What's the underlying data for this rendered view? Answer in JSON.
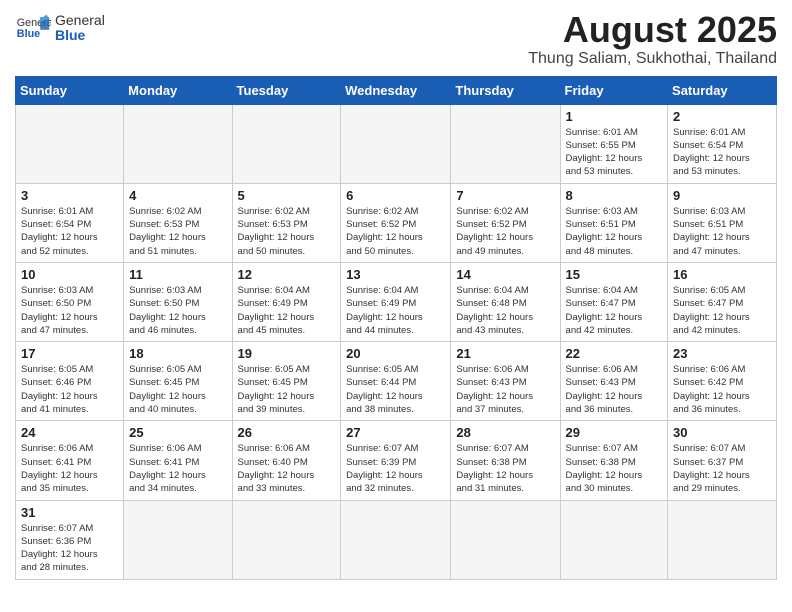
{
  "header": {
    "logo_general": "General",
    "logo_blue": "Blue",
    "month_year": "August 2025",
    "location": "Thung Saliam, Sukhothai, Thailand"
  },
  "weekdays": [
    "Sunday",
    "Monday",
    "Tuesday",
    "Wednesday",
    "Thursday",
    "Friday",
    "Saturday"
  ],
  "weeks": [
    [
      {
        "day": "",
        "info": ""
      },
      {
        "day": "",
        "info": ""
      },
      {
        "day": "",
        "info": ""
      },
      {
        "day": "",
        "info": ""
      },
      {
        "day": "",
        "info": ""
      },
      {
        "day": "1",
        "info": "Sunrise: 6:01 AM\nSunset: 6:55 PM\nDaylight: 12 hours\nand 53 minutes."
      },
      {
        "day": "2",
        "info": "Sunrise: 6:01 AM\nSunset: 6:54 PM\nDaylight: 12 hours\nand 53 minutes."
      }
    ],
    [
      {
        "day": "3",
        "info": "Sunrise: 6:01 AM\nSunset: 6:54 PM\nDaylight: 12 hours\nand 52 minutes."
      },
      {
        "day": "4",
        "info": "Sunrise: 6:02 AM\nSunset: 6:53 PM\nDaylight: 12 hours\nand 51 minutes."
      },
      {
        "day": "5",
        "info": "Sunrise: 6:02 AM\nSunset: 6:53 PM\nDaylight: 12 hours\nand 50 minutes."
      },
      {
        "day": "6",
        "info": "Sunrise: 6:02 AM\nSunset: 6:52 PM\nDaylight: 12 hours\nand 50 minutes."
      },
      {
        "day": "7",
        "info": "Sunrise: 6:02 AM\nSunset: 6:52 PM\nDaylight: 12 hours\nand 49 minutes."
      },
      {
        "day": "8",
        "info": "Sunrise: 6:03 AM\nSunset: 6:51 PM\nDaylight: 12 hours\nand 48 minutes."
      },
      {
        "day": "9",
        "info": "Sunrise: 6:03 AM\nSunset: 6:51 PM\nDaylight: 12 hours\nand 47 minutes."
      }
    ],
    [
      {
        "day": "10",
        "info": "Sunrise: 6:03 AM\nSunset: 6:50 PM\nDaylight: 12 hours\nand 47 minutes."
      },
      {
        "day": "11",
        "info": "Sunrise: 6:03 AM\nSunset: 6:50 PM\nDaylight: 12 hours\nand 46 minutes."
      },
      {
        "day": "12",
        "info": "Sunrise: 6:04 AM\nSunset: 6:49 PM\nDaylight: 12 hours\nand 45 minutes."
      },
      {
        "day": "13",
        "info": "Sunrise: 6:04 AM\nSunset: 6:49 PM\nDaylight: 12 hours\nand 44 minutes."
      },
      {
        "day": "14",
        "info": "Sunrise: 6:04 AM\nSunset: 6:48 PM\nDaylight: 12 hours\nand 43 minutes."
      },
      {
        "day": "15",
        "info": "Sunrise: 6:04 AM\nSunset: 6:47 PM\nDaylight: 12 hours\nand 42 minutes."
      },
      {
        "day": "16",
        "info": "Sunrise: 6:05 AM\nSunset: 6:47 PM\nDaylight: 12 hours\nand 42 minutes."
      }
    ],
    [
      {
        "day": "17",
        "info": "Sunrise: 6:05 AM\nSunset: 6:46 PM\nDaylight: 12 hours\nand 41 minutes."
      },
      {
        "day": "18",
        "info": "Sunrise: 6:05 AM\nSunset: 6:45 PM\nDaylight: 12 hours\nand 40 minutes."
      },
      {
        "day": "19",
        "info": "Sunrise: 6:05 AM\nSunset: 6:45 PM\nDaylight: 12 hours\nand 39 minutes."
      },
      {
        "day": "20",
        "info": "Sunrise: 6:05 AM\nSunset: 6:44 PM\nDaylight: 12 hours\nand 38 minutes."
      },
      {
        "day": "21",
        "info": "Sunrise: 6:06 AM\nSunset: 6:43 PM\nDaylight: 12 hours\nand 37 minutes."
      },
      {
        "day": "22",
        "info": "Sunrise: 6:06 AM\nSunset: 6:43 PM\nDaylight: 12 hours\nand 36 minutes."
      },
      {
        "day": "23",
        "info": "Sunrise: 6:06 AM\nSunset: 6:42 PM\nDaylight: 12 hours\nand 36 minutes."
      }
    ],
    [
      {
        "day": "24",
        "info": "Sunrise: 6:06 AM\nSunset: 6:41 PM\nDaylight: 12 hours\nand 35 minutes."
      },
      {
        "day": "25",
        "info": "Sunrise: 6:06 AM\nSunset: 6:41 PM\nDaylight: 12 hours\nand 34 minutes."
      },
      {
        "day": "26",
        "info": "Sunrise: 6:06 AM\nSunset: 6:40 PM\nDaylight: 12 hours\nand 33 minutes."
      },
      {
        "day": "27",
        "info": "Sunrise: 6:07 AM\nSunset: 6:39 PM\nDaylight: 12 hours\nand 32 minutes."
      },
      {
        "day": "28",
        "info": "Sunrise: 6:07 AM\nSunset: 6:38 PM\nDaylight: 12 hours\nand 31 minutes."
      },
      {
        "day": "29",
        "info": "Sunrise: 6:07 AM\nSunset: 6:38 PM\nDaylight: 12 hours\nand 30 minutes."
      },
      {
        "day": "30",
        "info": "Sunrise: 6:07 AM\nSunset: 6:37 PM\nDaylight: 12 hours\nand 29 minutes."
      }
    ],
    [
      {
        "day": "31",
        "info": "Sunrise: 6:07 AM\nSunset: 6:36 PM\nDaylight: 12 hours\nand 28 minutes."
      },
      {
        "day": "",
        "info": ""
      },
      {
        "day": "",
        "info": ""
      },
      {
        "day": "",
        "info": ""
      },
      {
        "day": "",
        "info": ""
      },
      {
        "day": "",
        "info": ""
      },
      {
        "day": "",
        "info": ""
      }
    ]
  ]
}
